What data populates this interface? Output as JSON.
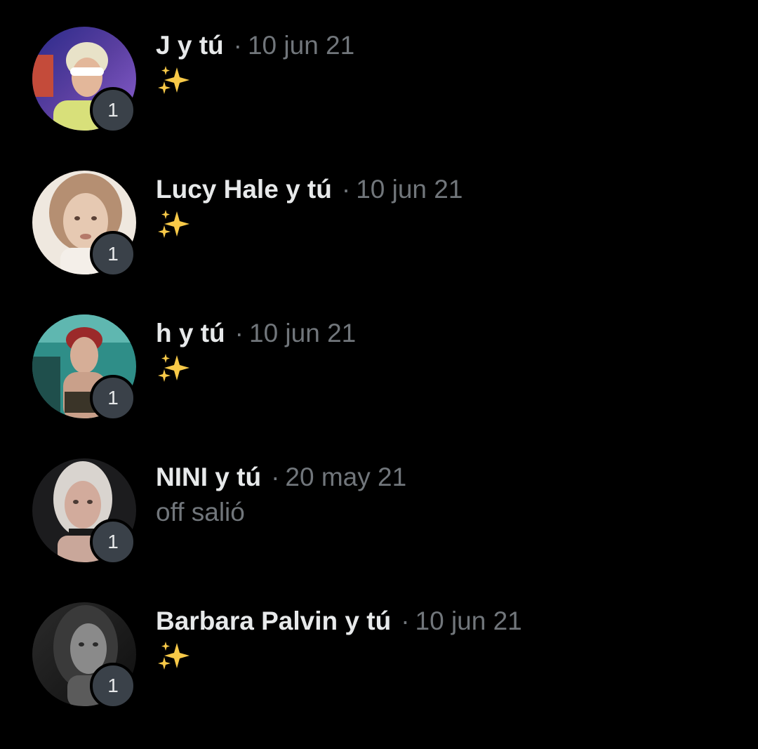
{
  "conversations": [
    {
      "name": "J y tú",
      "separator": "·",
      "date": "10 jun 21",
      "preview_icon": "sparkles-emoji",
      "preview_text": "",
      "unread_count": "1",
      "avatar_colors": [
        "#5a3fa0",
        "#c44b3a",
        "#d8e07a"
      ]
    },
    {
      "name": "Lucy Hale y tú",
      "separator": "·",
      "date": "10 jun 21",
      "preview_icon": "sparkles-emoji",
      "preview_text": "",
      "unread_count": "1",
      "avatar_colors": [
        "#efe8df",
        "#a7846c",
        "#d9c2ae"
      ]
    },
    {
      "name": "h y tú",
      "separator": "·",
      "date": "10 jun 21",
      "preview_icon": "sparkles-emoji",
      "preview_text": "",
      "unread_count": "1",
      "avatar_colors": [
        "#2f8e88",
        "#9b2a2a",
        "#cfa58e"
      ]
    },
    {
      "name": "NINI y tú",
      "separator": "·",
      "date": "20 may 21",
      "preview_icon": "",
      "preview_text": "off salió",
      "unread_count": "1",
      "avatar_colors": [
        "#1c1c1e",
        "#d9d4cf",
        "#c9a79a"
      ]
    },
    {
      "name": "Barbara Palvin y tú",
      "separator": "·",
      "date": "10 jun 21",
      "preview_icon": "sparkles-emoji",
      "preview_text": "",
      "unread_count": "1",
      "avatar_colors": [
        "#1a1a1a",
        "#8a8a8a",
        "#5b5b5b"
      ]
    }
  ],
  "colors": {
    "background": "#000000",
    "name_text": "#e7e9ea",
    "secondary_text": "#71767b",
    "badge_bg": "#3a4149",
    "sparkle": "#f7c948"
  }
}
